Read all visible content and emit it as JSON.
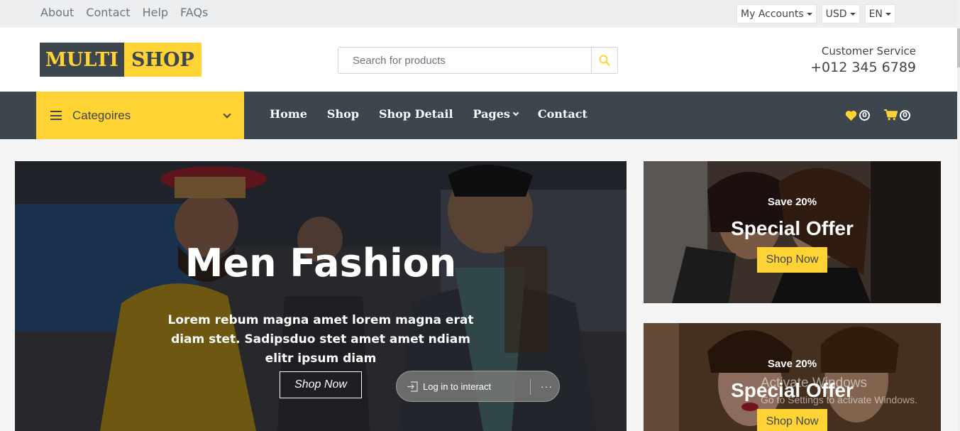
{
  "topbar": {
    "links": [
      "About",
      "Contact",
      "Help",
      "FAQs"
    ],
    "accounts": "My Accounts",
    "currency": "USD",
    "language": "EN"
  },
  "header": {
    "logo_part1": "MULTI",
    "logo_part2": "SHOP",
    "search_placeholder": "Search for products",
    "customer_service_label": "Customer Service",
    "phone": "+012 345 6789"
  },
  "nav": {
    "categories_label": "Categoires",
    "items": [
      "Home",
      "Shop",
      "Shop Detail",
      "Pages",
      "Contact"
    ],
    "wishlist_count": "0",
    "cart_count": "0"
  },
  "hero": {
    "title": "Men Fashion",
    "subtitle": "Lorem rebum magna amet lorem magna erat diam stet. Sadipsduo stet amet amet ndiam elitr ipsum diam",
    "button": "Shop Now"
  },
  "offers": [
    {
      "save": "Save 20%",
      "title": "Special Offer",
      "button": "Shop Now"
    },
    {
      "save": "Save 20%",
      "title": "Special Offer",
      "button": "Shop Now"
    }
  ],
  "overlay": {
    "login_label": "Log in to interact",
    "more": "···",
    "watermark_title": "Activate Windows",
    "watermark_sub": "Go to Settings to activate Windows."
  },
  "colors": {
    "accent": "#FFD333",
    "dark": "#3D464D"
  }
}
